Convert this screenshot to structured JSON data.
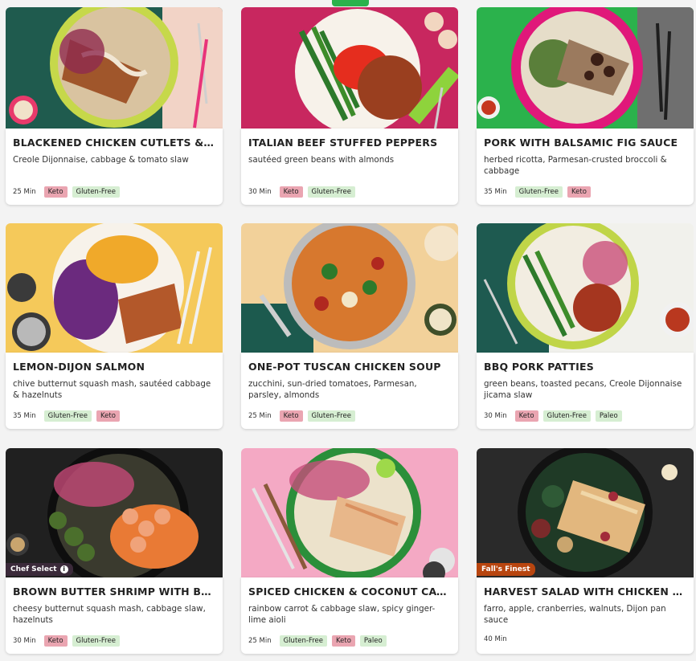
{
  "colors": {
    "keto": "#eaa5b1",
    "gluten_free": "#d6eed2",
    "accent": "#2bb24c"
  },
  "cards": [
    {
      "title": "BLACKENED CHICKEN CUTLETS & “GRI...",
      "desc": "Creole Dijonnaise, cabbage & tomato slaw",
      "time": "25 Min",
      "tags": [
        "Keto",
        "Gluten-Free"
      ],
      "badge": ""
    },
    {
      "title": "ITALIAN BEEF STUFFED PEPPERS",
      "desc": "sautéed green beans with almonds",
      "time": "30 Min",
      "tags": [
        "Keto",
        "Gluten-Free"
      ],
      "badge": ""
    },
    {
      "title": "PORK WITH BALSAMIC FIG SAUCE",
      "desc": "herbed ricotta, Parmesan-crusted broccoli & cabbage",
      "time": "35 Min",
      "tags": [
        "Gluten-Free",
        "Keto"
      ],
      "badge": ""
    },
    {
      "title": "LEMON-DIJON SALMON",
      "desc": "chive butternut squash mash, sautéed cabbage & hazelnuts",
      "time": "35 Min",
      "tags": [
        "Gluten-Free",
        "Keto"
      ],
      "badge": ""
    },
    {
      "title": "ONE-POT TUSCAN CHICKEN SOUP",
      "desc": "zucchini, sun-dried tomatoes, Parmesan, parsley, almonds",
      "time": "25 Min",
      "tags": [
        "Keto",
        "Gluten-Free"
      ],
      "badge": ""
    },
    {
      "title": "BBQ PORK PATTIES",
      "desc": "green beans, toasted pecans, Creole Dijonnaise jicama slaw",
      "time": "30 Min",
      "tags": [
        "Keto",
        "Gluten-Free",
        "Paleo"
      ],
      "badge": ""
    },
    {
      "title": "BROWN BUTTER SHRIMP WITH BACON...",
      "desc": "cheesy butternut squash mash, cabbage slaw, hazelnuts",
      "time": "30 Min",
      "tags": [
        "Keto",
        "Gluten-Free"
      ],
      "badge": "Chef Select"
    },
    {
      "title": "SPICED CHICKEN & COCONUT CAULIFL...",
      "desc": "rainbow carrot & cabbage slaw, spicy ginger-lime aioli",
      "time": "25 Min",
      "tags": [
        "Gluten-Free",
        "Keto",
        "Paleo"
      ],
      "badge": ""
    },
    {
      "title": "HARVEST SALAD WITH CHICKEN & BAC...",
      "desc": "farro, apple, cranberries, walnuts, Dijon pan sauce",
      "time": "40 Min",
      "tags": [],
      "badge": "Fall's Finest"
    }
  ]
}
